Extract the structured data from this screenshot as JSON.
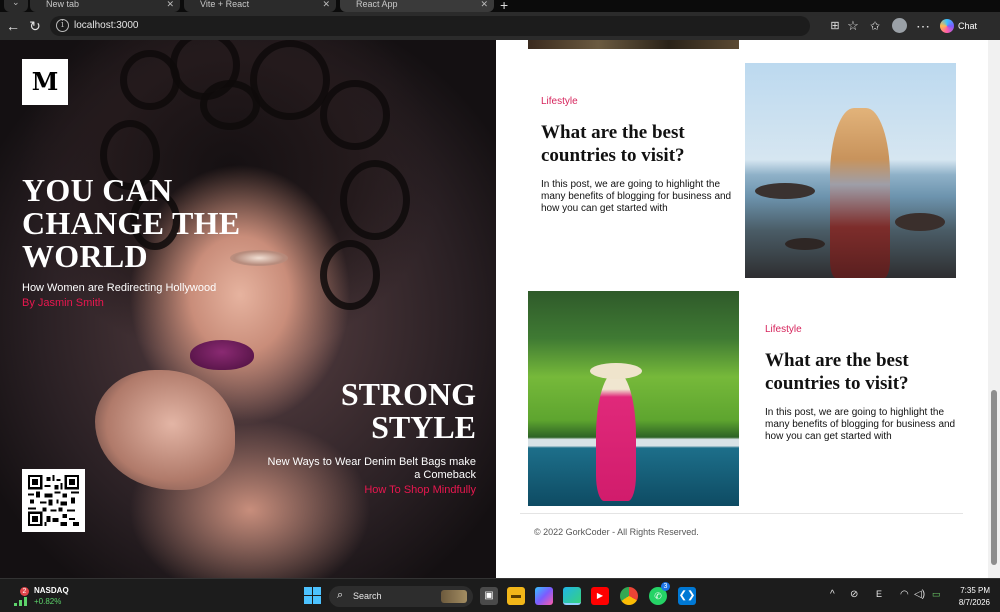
{
  "browser": {
    "tabs": [
      {
        "label": "New tab"
      },
      {
        "label": "Vite + React"
      },
      {
        "label": "React App"
      }
    ],
    "url": "localhost:3000",
    "chat_label": "Chat"
  },
  "hero": {
    "logo": "M",
    "headline": "YOU CAN CHANGE THE WORLD",
    "subtitle": "How Women are Redirecting Hollywood",
    "byline": "By Jasmin Smith",
    "feature_title": "STRONG STYLE",
    "feature_subtitle": "New Ways to Wear Denim Belt Bags make a Comeback",
    "feature_link": "How To Shop Mindfully"
  },
  "articles": [
    {
      "category": "Lifestyle",
      "title": "What are the best countries to visit?",
      "excerpt": "In this post, we are going to highlight the many benefits of blogging for business and how you can get started with"
    },
    {
      "category": "Lifestyle",
      "title": "What are the best countries to visit?",
      "excerpt": "In this post, we are going to highlight the many benefits of blogging for business and how you can get started with"
    }
  ],
  "footer": {
    "copyright": "© 2022 GorkCoder - All Rights Reserved."
  },
  "taskbar": {
    "stock_badge": "2",
    "stock_name": "NASDAQ",
    "stock_change": "+0.82%",
    "search_label": "Search",
    "whatsapp_badge": "3",
    "clock_time": "7:35 PM",
    "clock_date": "8/7/2026"
  },
  "colors": {
    "accent": "#e8174f",
    "category": "#d6245c",
    "win_blue": "#4cc2ff"
  }
}
